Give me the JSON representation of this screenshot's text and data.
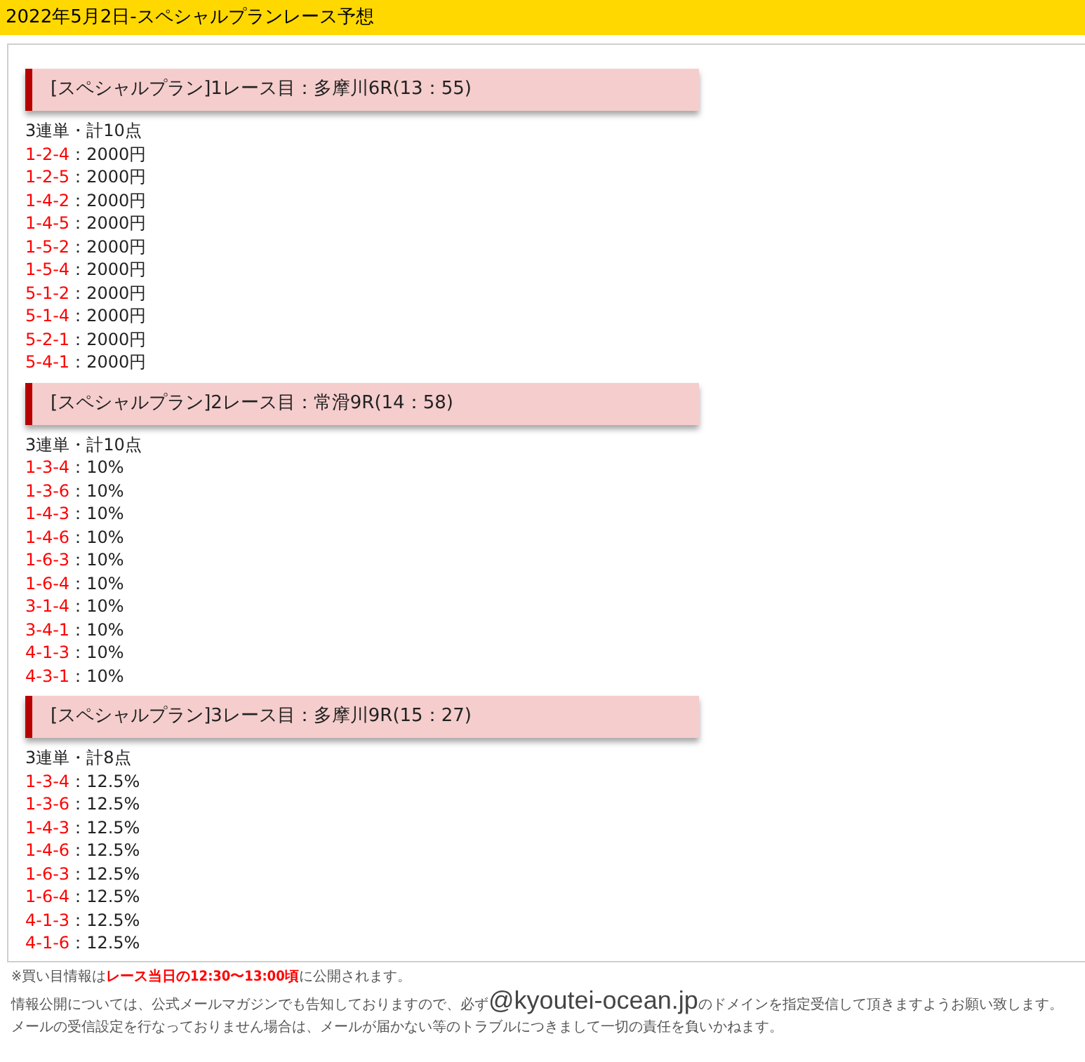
{
  "header": {
    "title": "2022年5月2日-スペシャルプランレース予想"
  },
  "sections": [
    {
      "heading": "[スペシャルプラン]1レース目：多摩川6R(13：55)",
      "summary": "3連単・計10点",
      "bets": [
        {
          "combo": "1-2-4",
          "amount": "：2000円"
        },
        {
          "combo": "1-2-5",
          "amount": "：2000円"
        },
        {
          "combo": "1-4-2",
          "amount": "：2000円"
        },
        {
          "combo": "1-4-5",
          "amount": "：2000円"
        },
        {
          "combo": "1-5-2",
          "amount": "：2000円"
        },
        {
          "combo": "1-5-4",
          "amount": "：2000円"
        },
        {
          "combo": "5-1-2",
          "amount": "：2000円"
        },
        {
          "combo": "5-1-4",
          "amount": "：2000円"
        },
        {
          "combo": "5-2-1",
          "amount": "：2000円"
        },
        {
          "combo": "5-4-1",
          "amount": "：2000円"
        }
      ]
    },
    {
      "heading": "[スペシャルプラン]2レース目：常滑9R(14：58)",
      "summary": "3連単・計10点",
      "bets": [
        {
          "combo": "1-3-4",
          "amount": "：10%"
        },
        {
          "combo": "1-3-6",
          "amount": "：10%"
        },
        {
          "combo": "1-4-3",
          "amount": "：10%"
        },
        {
          "combo": "1-4-6",
          "amount": "：10%"
        },
        {
          "combo": "1-6-3",
          "amount": "：10%"
        },
        {
          "combo": "1-6-4",
          "amount": "：10%"
        },
        {
          "combo": "3-1-4",
          "amount": "：10%"
        },
        {
          "combo": "3-4-1",
          "amount": "：10%"
        },
        {
          "combo": "4-1-3",
          "amount": "：10%"
        },
        {
          "combo": "4-3-1",
          "amount": "：10%"
        }
      ]
    },
    {
      "heading": "[スペシャルプラン]3レース目：多摩川9R(15：27)",
      "summary": "3連単・計8点",
      "bets": [
        {
          "combo": "1-3-4",
          "amount": "：12.5%"
        },
        {
          "combo": "1-3-6",
          "amount": "：12.5%"
        },
        {
          "combo": "1-4-3",
          "amount": "：12.5%"
        },
        {
          "combo": "1-4-6",
          "amount": "：12.5%"
        },
        {
          "combo": "1-6-3",
          "amount": "：12.5%"
        },
        {
          "combo": "1-6-4",
          "amount": "：12.5%"
        },
        {
          "combo": "4-1-3",
          "amount": "：12.5%"
        },
        {
          "combo": "4-1-6",
          "amount": "：12.5%"
        }
      ]
    }
  ],
  "footer": {
    "notice": "※買い目情報は**レース当日の12:30〜13:00頃**に公開されます。",
    "domain_note": {
      "before": "情報公開については、公式メールマガジンでも告知しておりますので、必ず",
      "domain": "@kyoutei-ocean.jp",
      "after": "のドメインを指定受信して頂きますようお願い致します。"
    },
    "disclaimer": "メールの受信設定を行なっておりません場合は、メールが届かない等のトラブルにつきまして一切の責任を負いかねます。"
  }
}
